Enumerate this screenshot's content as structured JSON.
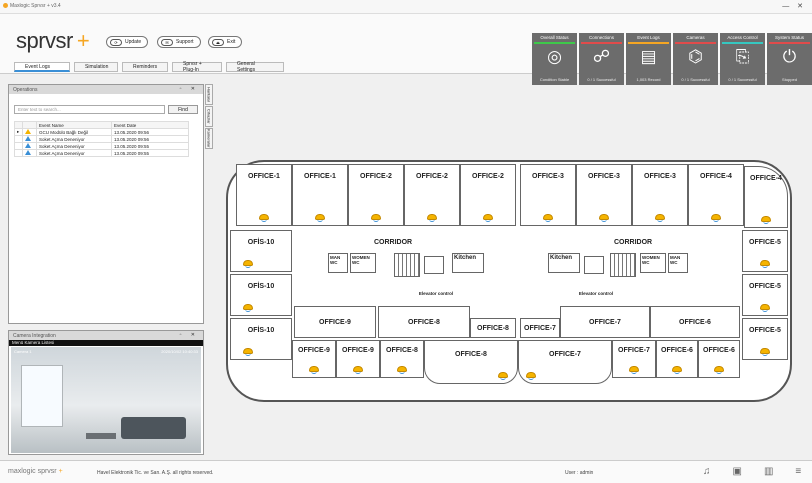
{
  "window": {
    "title": "Maxlogic Sprvsr + v3.4",
    "controls": "— ✕"
  },
  "header": {
    "logo_text": "sprvsr",
    "logo_plus": "+",
    "buttons": [
      {
        "label": "Update",
        "icon": "refresh-icon"
      },
      {
        "label": "Support",
        "icon": "chat-icon"
      },
      {
        "label": "Exit",
        "icon": "exit-icon"
      }
    ]
  },
  "tabs": [
    "Event Logs",
    "Simulation",
    "Reminders",
    "Sprvsr + Plug-In",
    "General Settings"
  ],
  "tiles": [
    {
      "title": "Overall Status",
      "bottom": "Condition Stable",
      "icon": "radar-icon",
      "bar_color": "#3ec94a"
    },
    {
      "title": "Connections",
      "bottom": "0 / 1 Successful",
      "icon": "network-icon",
      "bar_color": "#e14b4b"
    },
    {
      "title": "Event Logs",
      "bottom": "1,003 Record",
      "icon": "log-icon",
      "bar_color": "#f5a623"
    },
    {
      "title": "Cameras",
      "bottom": "0 / 1 Successful",
      "icon": "camera-icon",
      "bar_color": "#e14b4b"
    },
    {
      "title": "Access Control",
      "bottom": "0 / 1 Successful",
      "icon": "door-icon",
      "bar_color": "#e14b4b"
    },
    {
      "title": "System Status",
      "bottom": "Stopped",
      "icon": "power-icon",
      "bar_color": "#e14b4b"
    }
  ],
  "operations": {
    "title": "Operations",
    "search_placeholder": "Enter text to search...",
    "find_label": "Find",
    "columns": [
      "",
      "",
      "Event Name",
      "Event Date"
    ],
    "rows": [
      {
        "marker": "▸",
        "icon": "warning-icon",
        "name": "GCU Modülü Bağlı Değil",
        "date": "13.05.2020 09:56"
      },
      {
        "marker": "",
        "icon": "info-icon",
        "name": "Soket Açma Deneniyor",
        "date": "13.05.2020 09:56"
      },
      {
        "marker": "",
        "icon": "info-icon",
        "name": "Soket Açma Deneniyor",
        "date": "13.05.2020 09:55"
      },
      {
        "marker": "",
        "icon": "info-icon",
        "name": "Soket Açma Deneniyor",
        "date": "13.05.2020 09:55"
      }
    ],
    "side_tabs": [
      "Haritalar",
      "Cihazlar",
      "Kameralar"
    ]
  },
  "camera": {
    "title": "Camera Integration",
    "menu": "Menü   Kamera Listesi",
    "camera_label": "Camera 1",
    "timestamp": "2020/10/02 10:40:33"
  },
  "floorplan": {
    "rooms_top": [
      "OFFICE-1",
      "OFFICE-1",
      "OFFICE-2",
      "OFFICE-2",
      "OFFICE-2",
      "OFFICE-3",
      "OFFICE-3",
      "OFFICE-3",
      "OFFICE-4",
      "OFFICE-4"
    ],
    "left_rooms": [
      "OFİS-10",
      "OFİS-10",
      "OFİS-10"
    ],
    "right_rooms": [
      "OFFICE-5",
      "OFFICE-5",
      "OFFICE-5"
    ],
    "corridor_label": "CORRIDOR",
    "man_wc": "MAN WC",
    "women_wc": "WOMEN WC",
    "kitchen": "Kitchen",
    "elevator": "Elevator control",
    "inner_rooms": [
      "OFFICE-9",
      "OFFICE-8",
      "OFFICE-8",
      "OFFICE-7",
      "OFFICE-7",
      "OFFICE-6"
    ],
    "bottom_rooms": [
      "OFFICE-9",
      "OFFICE-9",
      "OFFICE-8",
      "OFFICE-8",
      "OFFICE-7",
      "OFFICE-7",
      "OFFICE-6",
      "OFFICE-6"
    ]
  },
  "status": {
    "brand": "maxlogic sprvsr",
    "brand_plus": "+",
    "copyright": "Havel Elektronik Tic. ve San. A.Ş. all rights reserved.",
    "user": "User :  admin"
  }
}
